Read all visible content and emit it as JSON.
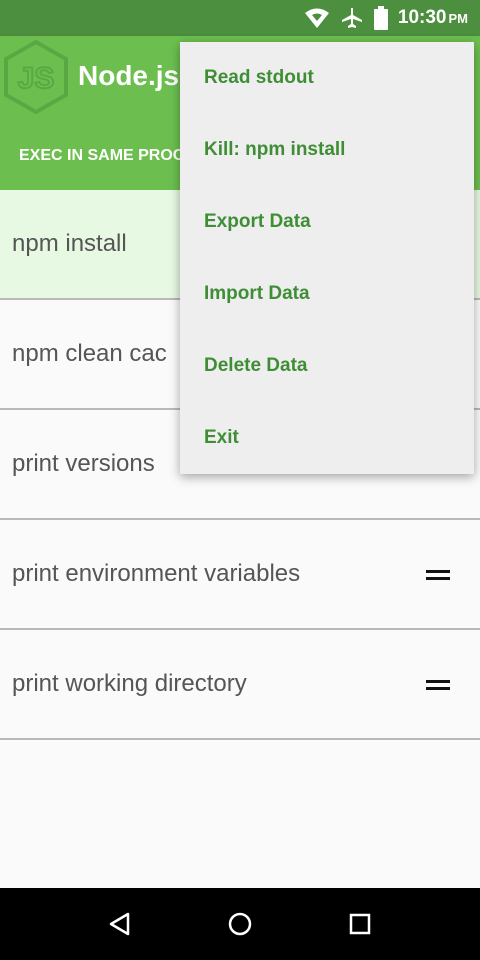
{
  "status_bar": {
    "time": "10:30",
    "ampm": "PM",
    "icons": [
      "wifi-icon",
      "airplane-mode-icon",
      "battery-icon"
    ]
  },
  "app_bar": {
    "title": "Node.js",
    "tab_label": "EXEC IN SAME PROC",
    "logo": "nodejs-logo-icon"
  },
  "list": {
    "items": [
      {
        "label": "npm install",
        "active": true
      },
      {
        "label": "npm clean cac"
      },
      {
        "label": "print versions"
      },
      {
        "label": "print environment variables"
      },
      {
        "label": "print working directory"
      }
    ]
  },
  "overflow_menu": {
    "items": [
      {
        "label": "Read stdout"
      },
      {
        "label": "Kill: npm install"
      },
      {
        "label": "Export Data"
      },
      {
        "label": "Import Data"
      },
      {
        "label": "Delete Data"
      },
      {
        "label": "Exit"
      }
    ]
  },
  "nav_bar": {
    "buttons": [
      "back-icon",
      "home-icon",
      "recents-icon"
    ]
  },
  "colors": {
    "status_bar": "#4c8f3f",
    "app_bar": "#6cbf4f",
    "menu_text": "#3f8e36",
    "active_row": "#e8f9e3"
  }
}
